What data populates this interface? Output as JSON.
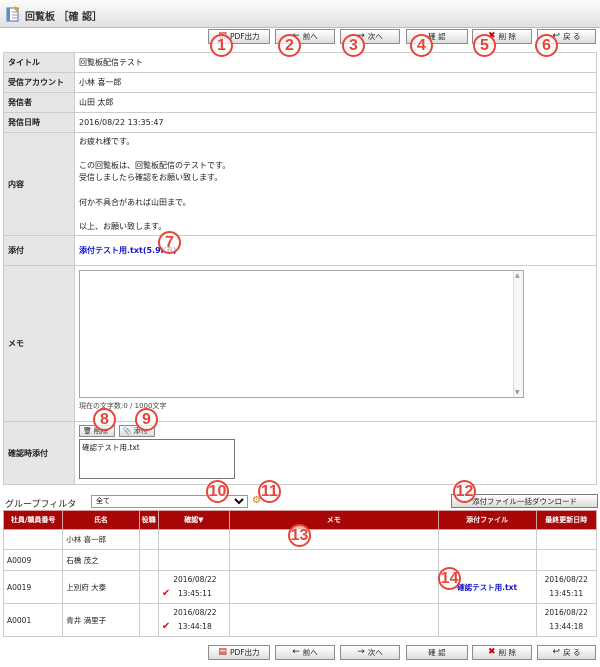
{
  "header": {
    "title": "回覧板 ［確 認］"
  },
  "toolbar": {
    "pdf": "PDF出力",
    "prev": "前へ",
    "next": "次へ",
    "confirm": "確 認",
    "delete": "削 除",
    "back": "戻 る"
  },
  "callouts": [
    "1",
    "2",
    "3",
    "4",
    "5",
    "6",
    "7",
    "8",
    "9",
    "10",
    "11",
    "12",
    "13",
    "14"
  ],
  "form": {
    "title_label": "タイトル",
    "title_value": "回覧板配信テスト",
    "recipient_label": "受信アカウント",
    "recipient_value": "小林 喜一郎",
    "sender_label": "発信者",
    "sender_value": "山田 太郎",
    "sent_label": "発信日時",
    "sent_value": "2016/08/22 13:35:47",
    "content_label": "内容",
    "content_lines": [
      "お疲れ様です。",
      "",
      "この回覧板は、回覧板配信のテストです。",
      "受信しましたら確認をお願い致します。",
      "",
      "何か不具合があれば山田まで。",
      "",
      "以上、お願い致します。"
    ],
    "attach_label": "添付",
    "attach_link": "添付テスト用.txt(5.9KB)",
    "memo_label": "メモ",
    "memo_counter": "現在の文字数:0 / 1000文字",
    "confirm_attach_label": "確認時添付",
    "delete_btn": "削除",
    "attach_btn": "添付",
    "attached_file": "確認テスト用.txt"
  },
  "filter": {
    "label": "グループフィルタ",
    "selected": "全て",
    "download_btn": "添付ファイル一括ダウンロード"
  },
  "grid": {
    "headers": [
      "社員/職員番号",
      "氏名",
      "役職",
      "確認▼",
      "メモ",
      "添付ファイル",
      "最終更新日時"
    ],
    "rows": [
      {
        "id": "",
        "name": "小林 喜一郎",
        "role": "",
        "check": "",
        "confirm_date": "",
        "confirm_time": "",
        "memo": "",
        "file": "",
        "upd_date": "",
        "upd_time": ""
      },
      {
        "id": "A0009",
        "name": "石橋 茂之",
        "role": "",
        "check": "",
        "confirm_date": "",
        "confirm_time": "",
        "memo": "",
        "file": "",
        "upd_date": "",
        "upd_time": ""
      },
      {
        "id": "A0019",
        "name": "上別府 大泰",
        "role": "",
        "check": "✔",
        "confirm_date": "2016/08/22",
        "confirm_time": "13:45:11",
        "memo": "",
        "file": "確認テスト用.txt",
        "upd_date": "2016/08/22",
        "upd_time": "13:45:11"
      },
      {
        "id": "A0001",
        "name": "青井 満里子",
        "role": "",
        "check": "✔",
        "confirm_date": "2016/08/22",
        "confirm_time": "13:44:18",
        "memo": "",
        "file": "",
        "upd_date": "2016/08/22",
        "upd_time": "13:44:18"
      }
    ]
  }
}
